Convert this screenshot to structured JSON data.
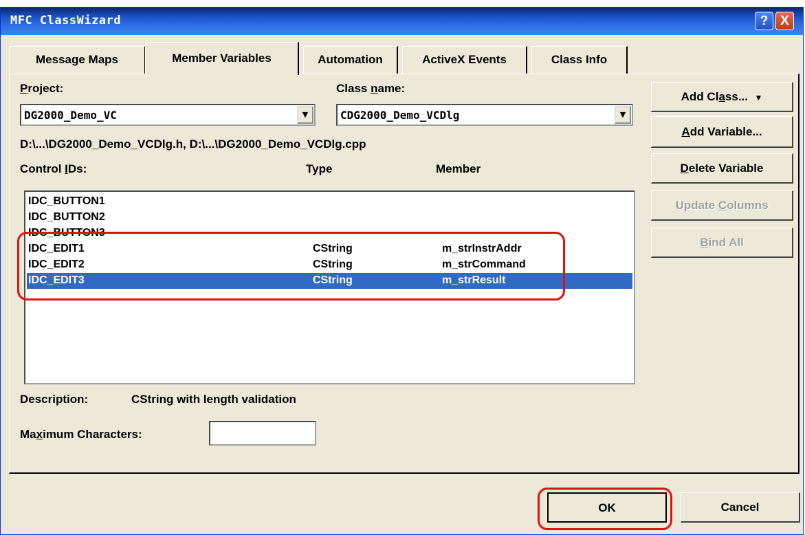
{
  "window": {
    "title": "MFC ClassWizard",
    "help_label": "?",
    "close_label": "X"
  },
  "tabs": [
    {
      "label": "Message Maps",
      "active": false
    },
    {
      "label": "Member Variables",
      "active": true
    },
    {
      "label": "Automation",
      "active": false
    },
    {
      "label": "ActiveX Events",
      "active": false
    },
    {
      "label": "Class Info",
      "active": false
    }
  ],
  "project": {
    "label_pre": "",
    "label_ul": "P",
    "label_post": "roject:",
    "value": "DG2000_Demo_VC"
  },
  "class_name": {
    "label_pre": "Class ",
    "label_ul": "n",
    "label_post": "ame:",
    "value": "CDG2000_Demo_VCDlg"
  },
  "files_text": "D:\\...\\DG2000_Demo_VCDlg.h, D:\\...\\DG2000_Demo_VCDlg.cpp",
  "list": {
    "header_pre": "Control ",
    "header_ul": "I",
    "header_post": "Ds:",
    "header_type": "Type",
    "header_member": "Member",
    "rows": [
      {
        "id": "IDC_BUTTON1",
        "type": "",
        "member": "",
        "selected": false
      },
      {
        "id": "IDC_BUTTON2",
        "type": "",
        "member": "",
        "selected": false
      },
      {
        "id": "IDC_BUTTON3",
        "type": "",
        "member": "",
        "selected": false
      },
      {
        "id": "IDC_EDIT1",
        "type": "CString",
        "member": "m_strInstrAddr",
        "selected": false
      },
      {
        "id": "IDC_EDIT2",
        "type": "CString",
        "member": "m_strCommand",
        "selected": false
      },
      {
        "id": "IDC_EDIT3",
        "type": "CString",
        "member": "m_strResult",
        "selected": true
      }
    ]
  },
  "buttons": {
    "add_class": {
      "pre": "Add Cl",
      "ul": "a",
      "post": "ss...",
      "arrow": "▼",
      "enabled": true
    },
    "add_variable": {
      "pre": "",
      "ul": "A",
      "post": "dd Variable...",
      "enabled": true
    },
    "delete_variable": {
      "pre": "",
      "ul": "D",
      "post": "elete Variable",
      "enabled": true
    },
    "update_columns": {
      "pre": "Update ",
      "ul": "C",
      "post": "olumns",
      "enabled": false
    },
    "bind_all": {
      "pre": "",
      "ul": "B",
      "post": "ind All",
      "enabled": false
    },
    "ok": "OK",
    "cancel": "Cancel"
  },
  "description": {
    "label": "Description:",
    "value": "CString with length validation"
  },
  "max_chars": {
    "label_pre": "Ma",
    "label_ul": "x",
    "label_post": "imum Characters:",
    "value": ""
  },
  "colors": {
    "title_bar": "#0a246a",
    "dialog_bg": "#ece9d8",
    "selection": "#316ac5",
    "highlight_box": "#e01010"
  }
}
